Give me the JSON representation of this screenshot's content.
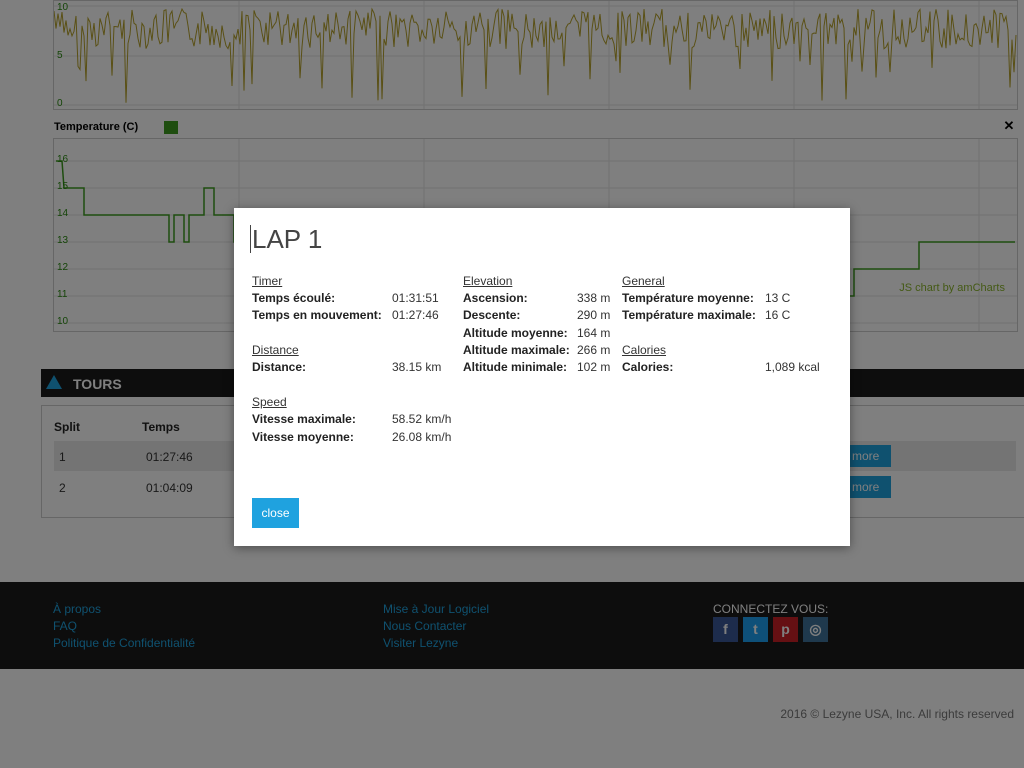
{
  "temperature_chart": {
    "title": "Temperature (C)",
    "legend_color": "#3c9a1e",
    "credit": "JS chart by amCharts",
    "y_ticks": [
      "16",
      "15",
      "14",
      "13",
      "12",
      "11",
      "10"
    ],
    "close_icon": "close-icon"
  },
  "upper_chart": {
    "y_ticks": [
      "10",
      "5",
      "0"
    ],
    "line_color": "#b5a12a"
  },
  "tours": {
    "title": "TOURS",
    "columns": [
      "Split",
      "Temps"
    ],
    "rows": [
      {
        "split": "1",
        "temps": "01:27:46",
        "more": "more"
      },
      {
        "split": "2",
        "temps": "01:04:09",
        "more": "more"
      }
    ]
  },
  "footer": {
    "col1": [
      "À propos",
      "FAQ",
      "Politique de Confidentialité"
    ],
    "col2": [
      "Mise à Jour Logiciel",
      "Nous Contacter",
      "Visiter Lezyne"
    ],
    "connect": "CONNECTEZ VOUS:",
    "social": [
      {
        "icon": "facebook-icon",
        "glyph": "f",
        "color": "#3b5998"
      },
      {
        "icon": "twitter-icon",
        "glyph": "t",
        "color": "#1da1f2"
      },
      {
        "icon": "pinterest-icon",
        "glyph": "p",
        "color": "#cb2027"
      },
      {
        "icon": "instagram-icon",
        "glyph": "◎",
        "color": "#3f729b"
      }
    ],
    "copyright": "2016 © Lezyne USA, Inc. All rights reserved"
  },
  "modal": {
    "title": "LAP 1",
    "timer": {
      "heading": "Timer",
      "elapsed_label": "Temps écoulé:",
      "elapsed_value": "01:31:51",
      "moving_label": "Temps en mouvement:",
      "moving_value": "01:27:46"
    },
    "distance": {
      "heading": "Distance",
      "label": "Distance:",
      "value": "38.15 km"
    },
    "speed": {
      "heading": "Speed",
      "max_label": "Vitesse maximale:",
      "max_value": "58.52 km/h",
      "avg_label": "Vitesse moyenne:",
      "avg_value": "26.08 km/h"
    },
    "elevation": {
      "heading": "Elevation",
      "ascent_label": "Ascension:",
      "ascent_value": "338 m",
      "descent_label": "Descente:",
      "descent_value": "290 m",
      "avg_label": "Altitude moyenne:",
      "avg_value": "164 m",
      "max_label": "Altitude maximale:",
      "max_value": "266 m",
      "min_label": "Altitude minimale:",
      "min_value": "102 m"
    },
    "general": {
      "heading": "General",
      "avg_temp_label": "Température moyenne:",
      "avg_temp_value": "13 C",
      "max_temp_label": "Température maximale:",
      "max_temp_value": "16 C"
    },
    "calories": {
      "heading": "Calories",
      "label": "Calories:",
      "value": "1,089 kcal"
    },
    "close_label": "close"
  }
}
